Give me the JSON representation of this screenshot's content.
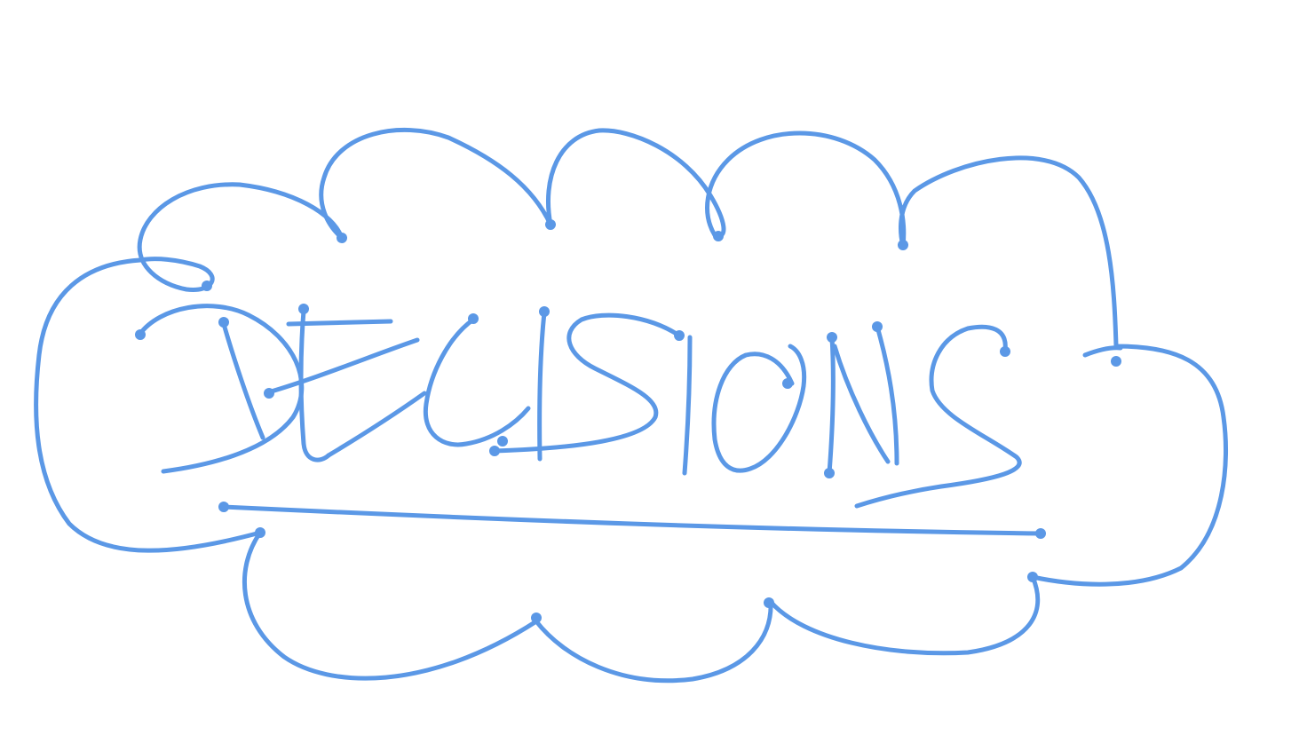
{
  "sketch": {
    "word": "DECISIONS",
    "ink_color": "#5B98E6",
    "background": "#FFFFFF",
    "shape": "cloud",
    "underlined": true
  }
}
